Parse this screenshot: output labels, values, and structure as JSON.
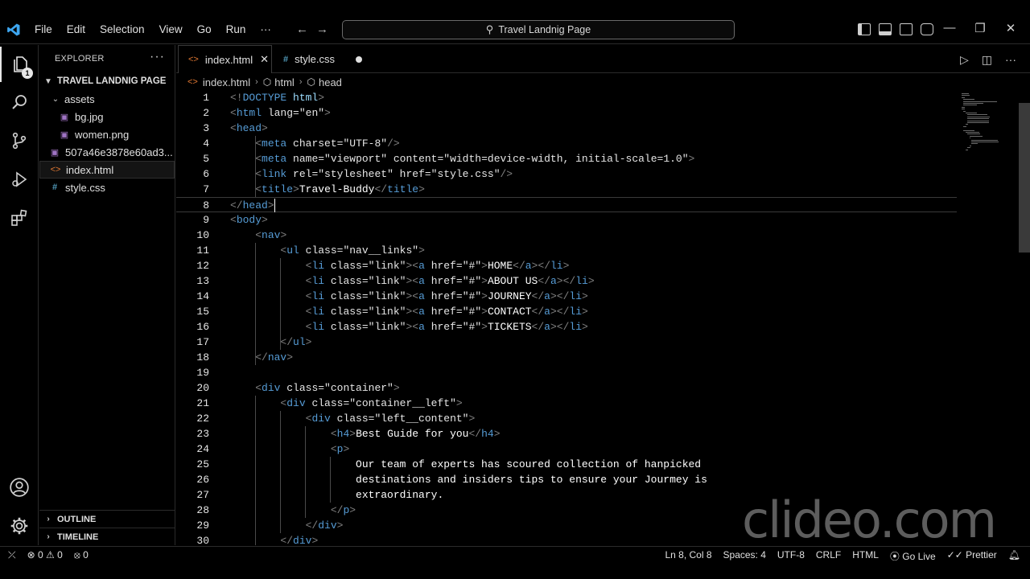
{
  "menu": [
    "File",
    "Edit",
    "Selection",
    "View",
    "Go",
    "Run",
    "···"
  ],
  "search": {
    "text": "Travel Landnig Page"
  },
  "explorer": {
    "title": "EXPLORER",
    "more": "···",
    "project": "TRAVEL LANDNIG PAGE",
    "items": [
      {
        "label": "assets",
        "kind": "folder"
      },
      {
        "label": "bg.jpg",
        "kind": "image"
      },
      {
        "label": "women.png",
        "kind": "image"
      },
      {
        "label": "507a46e3878e60ad3...",
        "kind": "image"
      },
      {
        "label": "index.html",
        "kind": "html"
      },
      {
        "label": "style.css",
        "kind": "css"
      }
    ],
    "outline": "OUTLINE",
    "timeline": "TIMELINE"
  },
  "activity_badge": "1",
  "tabs": [
    {
      "label": "index.html",
      "active": true
    },
    {
      "label": "style.css",
      "modified": true
    }
  ],
  "breadcrumb": [
    "index.html",
    "html",
    "head"
  ],
  "line_numbers": [
    "1",
    "2",
    "3",
    "4",
    "5",
    "6",
    "7",
    "8",
    "9",
    "10",
    "11",
    "12",
    "13",
    "14",
    "15",
    "16",
    "17",
    "18",
    "19",
    "20",
    "21",
    "22",
    "23",
    "24",
    "25",
    "26",
    "27",
    "28",
    "29",
    "30"
  ],
  "code": [
    "<!DOCTYPE html>",
    "<html lang=\"en\">",
    "<head>",
    "    <meta charset=\"UTF-8\"/>",
    "    <meta name=\"viewport\" content=\"width=device-width, initial-scale=1.0\">",
    "    <link rel=\"stylesheet\" href=\"style.css\"/>",
    "    <title>Travel-Buddy</title>",
    "</head>",
    "<body>",
    "    <nav>",
    "        <ul class=\"nav__links\">",
    "            <li class=\"link\"><a href=\"#\">HOME</a></li>",
    "            <li class=\"link\"><a href=\"#\">ABOUT US</a></li>",
    "            <li class=\"link\"><a href=\"#\">JOURNEY</a></li>",
    "            <li class=\"link\"><a href=\"#\">CONTACT</a></li>",
    "            <li class=\"link\"><a href=\"#\">TICKETS</a></li>",
    "        </ul>",
    "    </nav>",
    "",
    "    <div class=\"container\">",
    "        <div class=\"container__left\">",
    "            <div class=\"left__content\">",
    "                <h4>Best Guide for you</h4>",
    "                <p>",
    "                    Our team of experts has scoured collection of hanpicked",
    "                    destinations and insiders tips to ensure your Jourmey is",
    "                    extraordinary.",
    "                </p>",
    "            </div>",
    "        </div>"
  ],
  "current_line": 8,
  "watermark": "clideo.com",
  "status": {
    "errors": "0",
    "warnings": "0",
    "ports": "0",
    "position": "Ln 8, Col 8",
    "spaces": "Spaces: 4",
    "encoding": "UTF-8",
    "eol": "CRLF",
    "language": "HTML",
    "golive": "Go Live",
    "prettier": "Prettier"
  }
}
